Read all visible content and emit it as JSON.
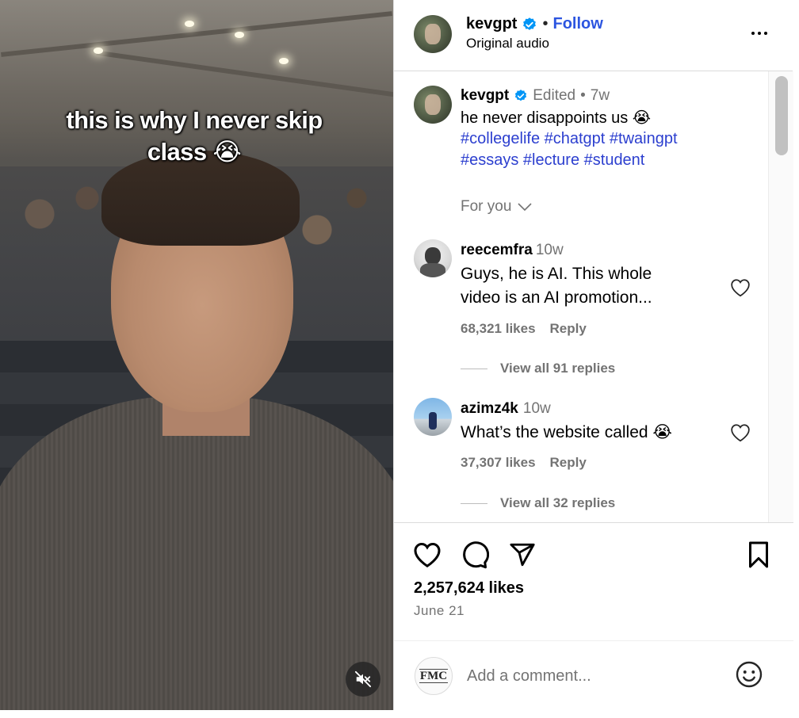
{
  "video": {
    "caption_line1": "this is why I never skip",
    "caption_line2": "class 😭",
    "mute_icon": "speaker-muted-icon"
  },
  "header": {
    "username": "kevgpt",
    "verified": true,
    "separator": "•",
    "follow_label": "Follow",
    "audio_label": "Original audio",
    "more_icon": "more-horizontal-icon"
  },
  "post": {
    "username": "kevgpt",
    "edited_label": "Edited",
    "separator": "•",
    "age": "7w",
    "text": "he never disappoints us 😭",
    "hashtags_line1": "#collegelife #chatgpt #twaingpt",
    "hashtags_line2": "#essays #lecture #student",
    "sort_label": "For you"
  },
  "comments": [
    {
      "username": "reecemfra",
      "age": "10w",
      "text_line1": "Guys, he is AI. This whole",
      "text_line2": "video is an AI promotion...",
      "likes": "68,321 likes",
      "reply_label": "Reply",
      "view_replies": "View all 91 replies"
    },
    {
      "username": "azimz4k",
      "age": "10w",
      "text": "What’s the website called 😭",
      "likes": "37,307 likes",
      "reply_label": "Reply",
      "view_replies": "View all 32 replies"
    }
  ],
  "actions": {
    "like_icon": "heart-icon",
    "comment_icon": "comment-icon",
    "share_icon": "share-icon",
    "save_icon": "bookmark-icon",
    "likes_count": "2,257,624 likes",
    "date": "June 21"
  },
  "add_comment": {
    "avatar_text": "FMC",
    "placeholder": "Add a comment...",
    "emoji_icon": "emoji-icon"
  },
  "colors": {
    "follow": "#2c55e0",
    "hashtag": "#2c3fcf",
    "verified": "#0095f6",
    "muted_text": "#737373",
    "border": "#dbdbdb"
  }
}
